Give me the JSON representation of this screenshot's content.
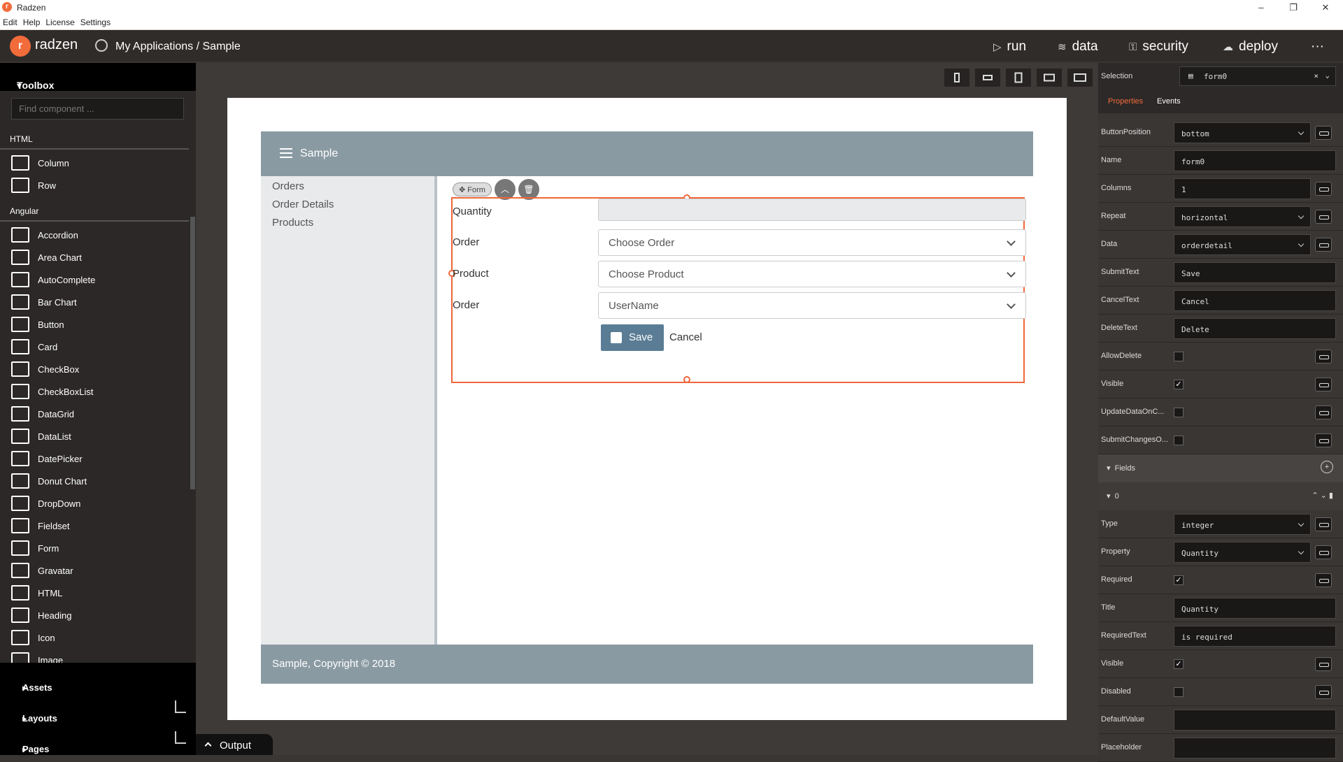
{
  "window": {
    "title": "Radzen"
  },
  "menu": [
    "Edit",
    "Help",
    "License",
    "Settings"
  ],
  "topbar": {
    "brand": "radzen",
    "breadcrumb": "My Applications / Sample",
    "nav": [
      {
        "label": "run",
        "icon": "play-icon"
      },
      {
        "label": "data",
        "icon": "layers-icon"
      },
      {
        "label": "security",
        "icon": "lock-icon"
      },
      {
        "label": "deploy",
        "icon": "cloud-upload-icon"
      }
    ],
    "more": "···"
  },
  "toolbox": {
    "title": "Toolbox",
    "search_placeholder": "Find component ...",
    "sections": {
      "html": "HTML",
      "angular": "Angular"
    },
    "html_items": [
      "Column",
      "Row"
    ],
    "angular_items": [
      "Accordion",
      "Area Chart",
      "AutoComplete",
      "Bar Chart",
      "Button",
      "Card",
      "CheckBox",
      "CheckBoxList",
      "DataGrid",
      "DataList",
      "DatePicker",
      "Donut Chart",
      "DropDown",
      "Fieldset",
      "Form",
      "Gravatar",
      "HTML",
      "Heading",
      "Icon",
      "Image"
    ],
    "bottom": [
      "Assets",
      "Layouts",
      "Pages"
    ]
  },
  "design": {
    "app_title": "Sample",
    "nav": [
      "Orders",
      "Order Details",
      "Products"
    ],
    "footer": "Sample, Copyright © 2018",
    "form_chip": "Form",
    "fields": [
      {
        "label": "Quantity",
        "value": ""
      },
      {
        "label": "Order",
        "value": "Choose Order"
      },
      {
        "label": "Product",
        "value": "Choose Product"
      },
      {
        "label": "Order",
        "value": "UserName"
      }
    ],
    "save": "Save",
    "cancel": "Cancel"
  },
  "output": "Output",
  "props": {
    "selection_label": "Selection",
    "selection_value": "form0",
    "tabs": [
      "Properties",
      "Events"
    ],
    "rows": [
      {
        "label": "ButtonPosition",
        "value": "bottom",
        "kind": "select",
        "bind": true
      },
      {
        "label": "Name",
        "value": "form0",
        "kind": "text",
        "bind": false
      },
      {
        "label": "Columns",
        "value": "1",
        "kind": "text",
        "bind": true
      },
      {
        "label": "Repeat",
        "value": "horizontal",
        "kind": "select",
        "bind": true
      },
      {
        "label": "Data",
        "value": "orderdetail",
        "kind": "select",
        "bind": true
      },
      {
        "label": "SubmitText",
        "value": "Save",
        "kind": "text",
        "bind": false
      },
      {
        "label": "CancelText",
        "value": "Cancel",
        "kind": "text",
        "bind": false
      },
      {
        "label": "DeleteText",
        "value": "Delete",
        "kind": "text",
        "bind": false
      },
      {
        "label": "AllowDelete",
        "value": "",
        "kind": "check",
        "bind": true
      },
      {
        "label": "Visible",
        "value": "✓",
        "kind": "check",
        "bind": true
      },
      {
        "label": "UpdateDataOnC...",
        "value": "",
        "kind": "check",
        "bind": true
      },
      {
        "label": "SubmitChangesO...",
        "value": "",
        "kind": "check",
        "bind": true
      }
    ],
    "fields_group": "Fields",
    "field0_group": "0",
    "field_rows": [
      {
        "label": "Type",
        "value": "integer",
        "kind": "select",
        "bind": true
      },
      {
        "label": "Property",
        "value": "Quantity",
        "kind": "select",
        "bind": true
      },
      {
        "label": "Required",
        "value": "✓",
        "kind": "check",
        "bind": true
      },
      {
        "label": "Title",
        "value": "Quantity",
        "kind": "text",
        "bind": false
      },
      {
        "label": "RequiredText",
        "value": "is required",
        "kind": "text",
        "bind": false
      },
      {
        "label": "Visible",
        "value": "✓",
        "kind": "check",
        "bind": true
      },
      {
        "label": "Disabled",
        "value": "",
        "kind": "check",
        "bind": true
      },
      {
        "label": "DefaultValue",
        "value": "",
        "kind": "text",
        "bind": false
      },
      {
        "label": "Placeholder",
        "value": "",
        "kind": "text",
        "bind": false
      }
    ]
  }
}
